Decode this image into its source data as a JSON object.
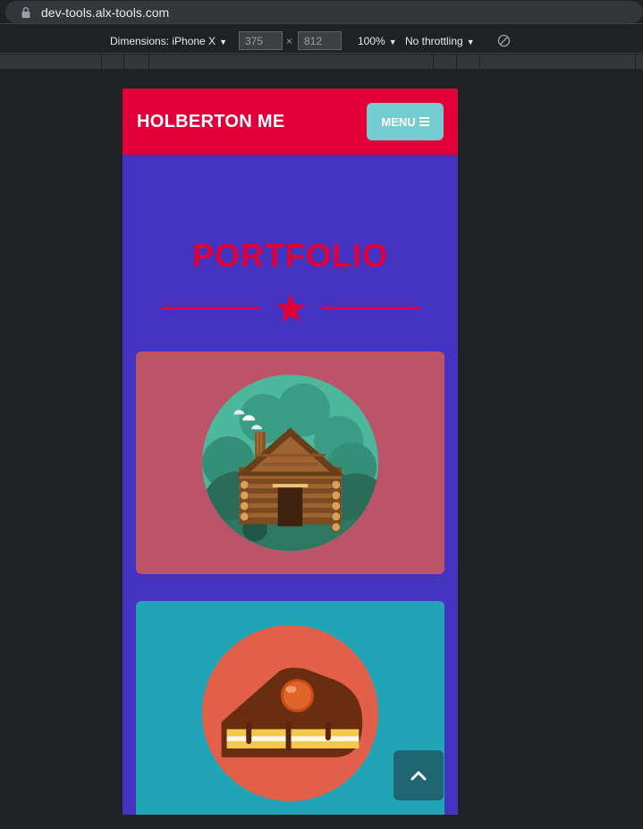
{
  "browser": {
    "url": "dev-tools.alx-tools.com"
  },
  "device_toolbar": {
    "dimensions_label": "Dimensions: iPhone X",
    "width_value": "375",
    "height_value": "812",
    "times": "×",
    "zoom": "100%",
    "throttling": "No throttling"
  },
  "site": {
    "brand": "HOLBERTON ME",
    "menu_label": "MENU",
    "section_title": "PORTFOLIO",
    "colors": {
      "header": "#e10037",
      "page": "#4433c0",
      "menu_button": "#74cdd1",
      "card1": "#bb5468",
      "card2": "#20a4b6",
      "back_to_top": "#1f6670"
    },
    "portfolio_items": [
      {
        "icon": "log-cabin-illustration"
      },
      {
        "icon": "cake-slice-illustration"
      }
    ],
    "back_to_top_icon": "chevron-up-icon"
  }
}
